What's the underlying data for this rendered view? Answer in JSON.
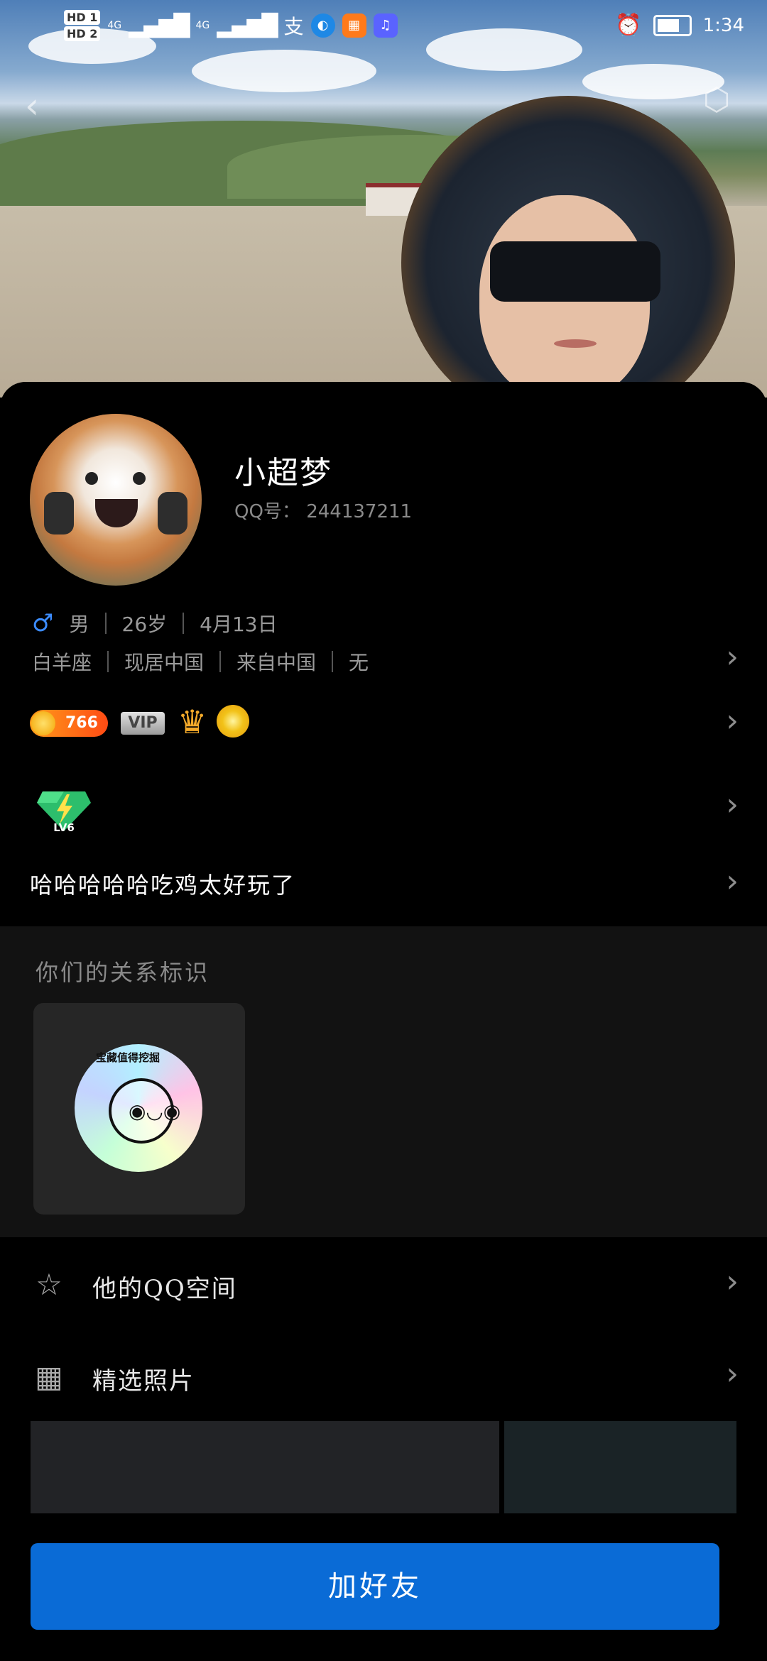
{
  "status_bar": {
    "sim1": "HD 1",
    "sim2": "HD 2",
    "network1": "4G",
    "network2": "4G",
    "alipay_icon": "支",
    "time": "1:34"
  },
  "profile": {
    "nickname": "小超梦",
    "qq_number_label": "QQ号：",
    "qq_number": "244137211",
    "gender_symbol": "♂",
    "gender": "男",
    "age": "26岁",
    "birthday": "4月13日",
    "zodiac": "白羊座",
    "residence": "现居中国",
    "origin": "来自中国",
    "extra": "无",
    "coin_count": "766",
    "vip_label": "VIP",
    "level_label": "LV6",
    "signature": "哈哈哈哈哈吃鸡太好玩了"
  },
  "relationship": {
    "title": "你们的关系标识",
    "badge_text": "宝藏值得挖掘"
  },
  "menu": {
    "qzone": "他的QQ空间",
    "photos": "精选照片"
  },
  "actions": {
    "add_friend": "加好友"
  },
  "colors": {
    "accent": "#0a6bd6",
    "male": "#3c8cff"
  }
}
